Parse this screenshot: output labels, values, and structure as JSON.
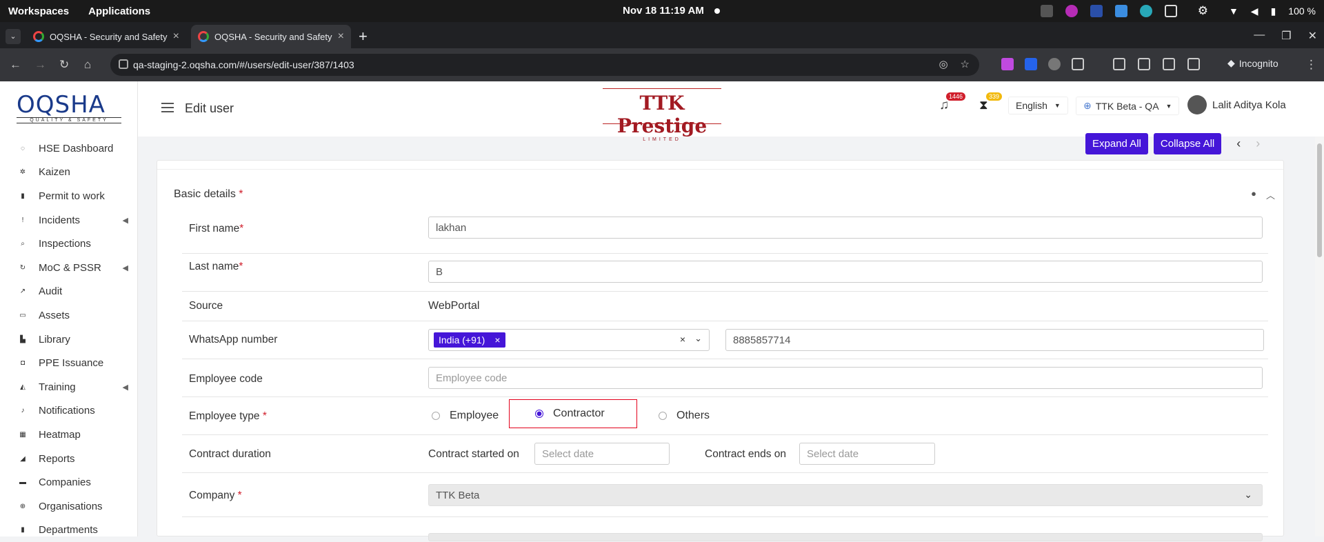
{
  "os": {
    "workspaces": "Workspaces",
    "applications": "Applications",
    "datetime": "Nov 18  11:19 AM",
    "battery": "100 %"
  },
  "browser": {
    "tabs": [
      {
        "title": "OQSHA - Security and Safety"
      },
      {
        "title": "OQSHA - Security and Safety"
      }
    ],
    "url": "qa-staging-2.oqsha.com/#/users/edit-user/387/1403",
    "incognito": "Incognito"
  },
  "sidebar": {
    "logo": "OQSHA",
    "logo_tag": "QUALITY & SAFETY",
    "items": [
      {
        "label": "HSE Dashboard",
        "icon": "dashboard-icon"
      },
      {
        "label": "Kaizen",
        "icon": "gear-icon"
      },
      {
        "label": "Permit to work",
        "icon": "document-icon"
      },
      {
        "label": "Incidents",
        "icon": "exclamation-icon"
      },
      {
        "label": "Inspections",
        "icon": "search-icon"
      },
      {
        "label": "MoC & PSSR",
        "icon": "refresh-icon"
      },
      {
        "label": "Audit",
        "icon": "chart-icon"
      },
      {
        "label": "Assets",
        "icon": "laptop-icon"
      },
      {
        "label": "Library",
        "icon": "book-icon"
      },
      {
        "label": "PPE Issuance",
        "icon": "bag-icon"
      },
      {
        "label": "Training",
        "icon": "graduation-icon"
      },
      {
        "label": "Notifications",
        "icon": "bell-icon"
      },
      {
        "label": "Heatmap",
        "icon": "map-icon"
      },
      {
        "label": "Reports",
        "icon": "area-chart-icon"
      },
      {
        "label": "Companies",
        "icon": "briefcase-icon"
      },
      {
        "label": "Organisations",
        "icon": "globe-icon"
      },
      {
        "label": "Departments",
        "icon": "building-icon"
      }
    ]
  },
  "header": {
    "title": "Edit user",
    "brand": "TTK Prestige",
    "brand_sub": "LIMITED",
    "notif_count": "1446",
    "hourglass_count": "339",
    "language": "English",
    "tenant": "TTK Beta - QA",
    "user": "Lalit Aditya Kola",
    "colors": {
      "accent": "#4516d8",
      "brand": "#a21a22",
      "required": "#d01e2b"
    }
  },
  "toolbar": {
    "expand_all": "Expand All",
    "collapse_all": "Collapse All"
  },
  "form": {
    "section_title": "Basic details",
    "required_mark": "*",
    "first_name": {
      "label": "First name",
      "value": "lakhan"
    },
    "last_name": {
      "label": "Last name",
      "value": "B"
    },
    "source": {
      "label": "Source",
      "value": "WebPortal"
    },
    "whatsapp": {
      "label": "WhatsApp number",
      "country": "India (+91)",
      "number": "8885857714"
    },
    "employee_code": {
      "label": "Employee code",
      "placeholder": "Employee code"
    },
    "employee_type": {
      "label": "Employee type",
      "options": [
        "Employee",
        "Contractor",
        "Others"
      ],
      "selected": "Contractor"
    },
    "contract": {
      "label": "Contract duration",
      "start_label": "Contract started on",
      "start_placeholder": "Select date",
      "end_label": "Contract ends on",
      "end_placeholder": "Select date"
    },
    "company": {
      "label": "Company",
      "value": "TTK Beta"
    }
  }
}
